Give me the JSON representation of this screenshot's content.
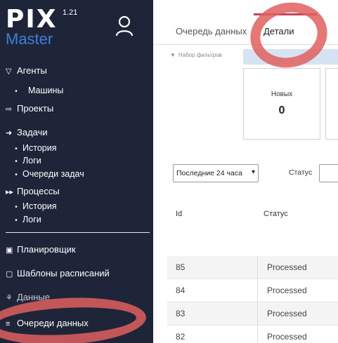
{
  "logo": {
    "pix": "PIX",
    "version": "1.21",
    "master": "Master"
  },
  "sidebar": {
    "agents": {
      "label": "Агенты",
      "icon": "filter-icon"
    },
    "agents_sub": [
      {
        "label": "Машины"
      }
    ],
    "projects": {
      "label": "Проекты",
      "icon": "arrow-right-icon"
    },
    "tasks": {
      "label": "Задачи",
      "icon": "arrow-right-icon"
    },
    "tasks_sub": [
      {
        "label": "История"
      },
      {
        "label": "Логи"
      },
      {
        "label": "Очереди задач"
      }
    ],
    "processes": {
      "label": "Процессы",
      "icon": "fast-forward-icon"
    },
    "processes_sub": [
      {
        "label": "История"
      },
      {
        "label": "Логи"
      }
    ],
    "scheduler": {
      "label": "Планировщик",
      "icon": "calendar-check-icon"
    },
    "templates": {
      "label": "Шаблоны расписаний",
      "icon": "calendar-icon"
    },
    "data": {
      "label": "Данные",
      "icon": "database-icon"
    },
    "queues": {
      "label": "Очереди данных",
      "icon": "list-icon"
    }
  },
  "tabs": [
    {
      "label": "Очередь данных"
    },
    {
      "label": "Детали"
    }
  ],
  "filter": {
    "label": "Набор фильтров"
  },
  "cards": [
    {
      "title": "Новых",
      "value": "0"
    }
  ],
  "controls": {
    "period": "Последние 24 часа",
    "status_label": "Статус"
  },
  "table": {
    "headers": [
      "Id",
      "Статус"
    ],
    "rows": [
      {
        "id": "85",
        "status": "Processed"
      },
      {
        "id": "84",
        "status": "Processed"
      },
      {
        "id": "83",
        "status": "Processed"
      },
      {
        "id": "82",
        "status": "Processed"
      }
    ]
  },
  "colors": {
    "sidebar_bg": "#1e2539",
    "accent_blue": "#3f7fd9",
    "tab_active": "#c0445b",
    "annotation_red": "#e15f5f"
  }
}
